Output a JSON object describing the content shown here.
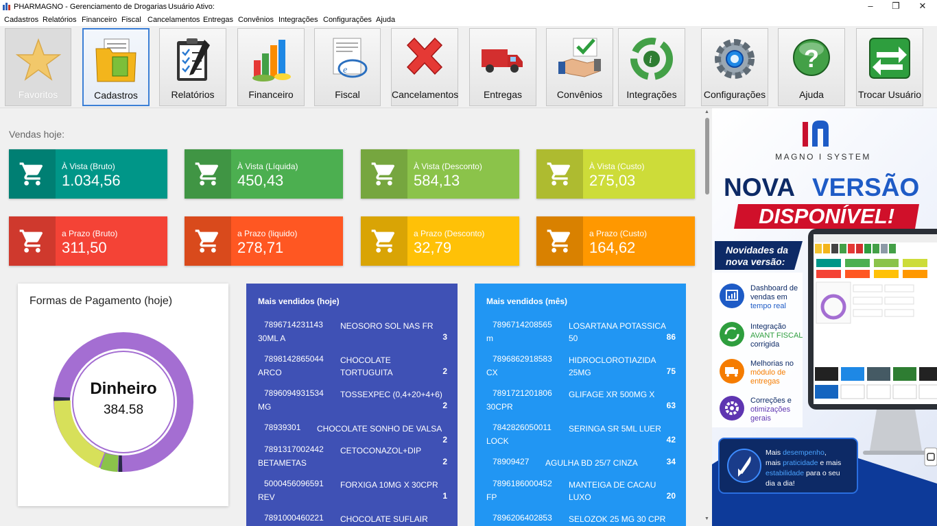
{
  "window": {
    "title": "PHARMAGNO - Gerenciamento de Drogarias",
    "user_label": "Usuário Ativo:"
  },
  "menu": [
    "Cadastros",
    "Relatórios",
    "Financeiro",
    "Fiscal",
    "Cancelamentos",
    "Entregas",
    "Convênios",
    "Integrações",
    "Configurações",
    "Ajuda"
  ],
  "toolbar": {
    "favoritos": "Favoritos",
    "cadastros": "Cadastros",
    "relatorios": "Relatórios",
    "financeiro": "Financeiro",
    "fiscal": "Fiscal",
    "cancelamentos": "Cancelamentos",
    "entregas": "Entregas",
    "convenios": "Convênios",
    "integracoes": "Integrações",
    "configuracoes": "Configurações",
    "ajuda": "Ajuda",
    "trocar": "Trocar Usuário"
  },
  "sales": {
    "heading": "Vendas hoje:",
    "cards": [
      {
        "label": "À Vista (Bruto)",
        "value": "1.034,56",
        "color": "#009688"
      },
      {
        "label": "À Vista (Líquida)",
        "value": "450,43",
        "color": "#4caf50"
      },
      {
        "label": "À Vista (Desconto)",
        "value": "584,13",
        "color": "#8bc34a"
      },
      {
        "label": "À Vista (Custo)",
        "value": "275,03",
        "color": "#cddc39"
      },
      {
        "label": "a Prazo (Bruto)",
        "value": "311,50",
        "color": "#f44336"
      },
      {
        "label": "a Prazo (liquido)",
        "value": "278,71",
        "color": "#ff5722"
      },
      {
        "label": "a Prazo (Desconto)",
        "value": "32,79",
        "color": "#ffc107"
      },
      {
        "label": "a Prazo (Custo)",
        "value": "164,62",
        "color": "#ff9800"
      }
    ]
  },
  "payments": {
    "title": "Formas de Pagamento (hoje)",
    "center_label": "Dinheiro",
    "center_value": "384.58",
    "colors": {
      "dinheiro": "#a46ed2",
      "second": "#d7e05a",
      "third": "#8bc34a",
      "fourth": "#2a2a4a"
    }
  },
  "top_today": {
    "title": "Mais vendidos (hoje)",
    "items": [
      {
        "code": "7896714231143",
        "name": "NEOSORO SOL NAS FR",
        "name2": "30ML A",
        "qty": "3"
      },
      {
        "code": "7898142865044",
        "name": "CHOCOLATE TORTUGUITA",
        "name2": "ARCO",
        "qty": "2"
      },
      {
        "code": "7896094931534",
        "name": "TOSSEXPEC (0,4+20+4+6)",
        "name2": "MG",
        "qty": "2"
      },
      {
        "code": "78939301",
        "name": "CHOCOLATE SONHO DE VALSA",
        "name2": "",
        "qty": "2"
      },
      {
        "code": "7891317002442",
        "name": "CETOCONAZOL+DIP",
        "name2": "BETAMETAS",
        "qty": "2"
      },
      {
        "code": "5000456096591",
        "name": "FORXIGA 10MG X 30CPR",
        "name2": "REV",
        "qty": "1"
      },
      {
        "code": "7891000460221",
        "name": "CHOCOLATE SUFLAIR",
        "name2": "",
        "qty": ""
      }
    ]
  },
  "top_month": {
    "title": "Mais vendidos (mês)",
    "items": [
      {
        "code": "7896714208565",
        "name": "LOSARTANA POTASSICA 50",
        "name2": "m",
        "qty": "86"
      },
      {
        "code": "7896862918583",
        "name": "HIDROCLOROTIAZIDA 25MG",
        "name2": "CX",
        "qty": "75"
      },
      {
        "code": "7891721201806",
        "name": "GLIFAGE XR 500MG X",
        "name2": "30CPR",
        "qty": "63"
      },
      {
        "code": "7842826050011",
        "name": "SERINGA SR 5ML LUER",
        "name2": "LOCK",
        "qty": "42"
      },
      {
        "code": "78909427",
        "name": "AGULHA BD 25/7 CINZA",
        "name2": "",
        "qty": "34"
      },
      {
        "code": "7896186000452",
        "name": "MANTEIGA DE CACAU LUXO",
        "name2": "FP",
        "qty": "20"
      },
      {
        "code": "7896206402853",
        "name": "SELOZOK 25 MG 30 CPR",
        "name2": "",
        "qty": ""
      }
    ]
  },
  "banner": {
    "brand": "MAGNO I SYSTEM",
    "headline1a": "NOVA",
    "headline1b": "VERSÃO",
    "headline2": "DISPONÍVEL!",
    "news_line1": "Novidades da",
    "news_line2": "nova versão:",
    "f1a": "Dashboard de",
    "f1b": "vendas em",
    "f1c": "tempo real",
    "f2a": "Integração",
    "f2b": "AVANT FISCAL",
    "f2c": "corrigida",
    "f3a": "Melhorias no",
    "f3b": "módulo de",
    "f3c": "entregas",
    "f4a": "Correções e",
    "f4b": "otimizações",
    "f4c": "gerais",
    "p1a": "Mais ",
    "p1b": "desempenho",
    "p1c": ",",
    "p2a": "mais ",
    "p2b": "praticidade",
    "p2c": " e mais",
    "p3a": "estabilidade",
    "p3b": " para o seu",
    "p4": "dia a dia!"
  }
}
